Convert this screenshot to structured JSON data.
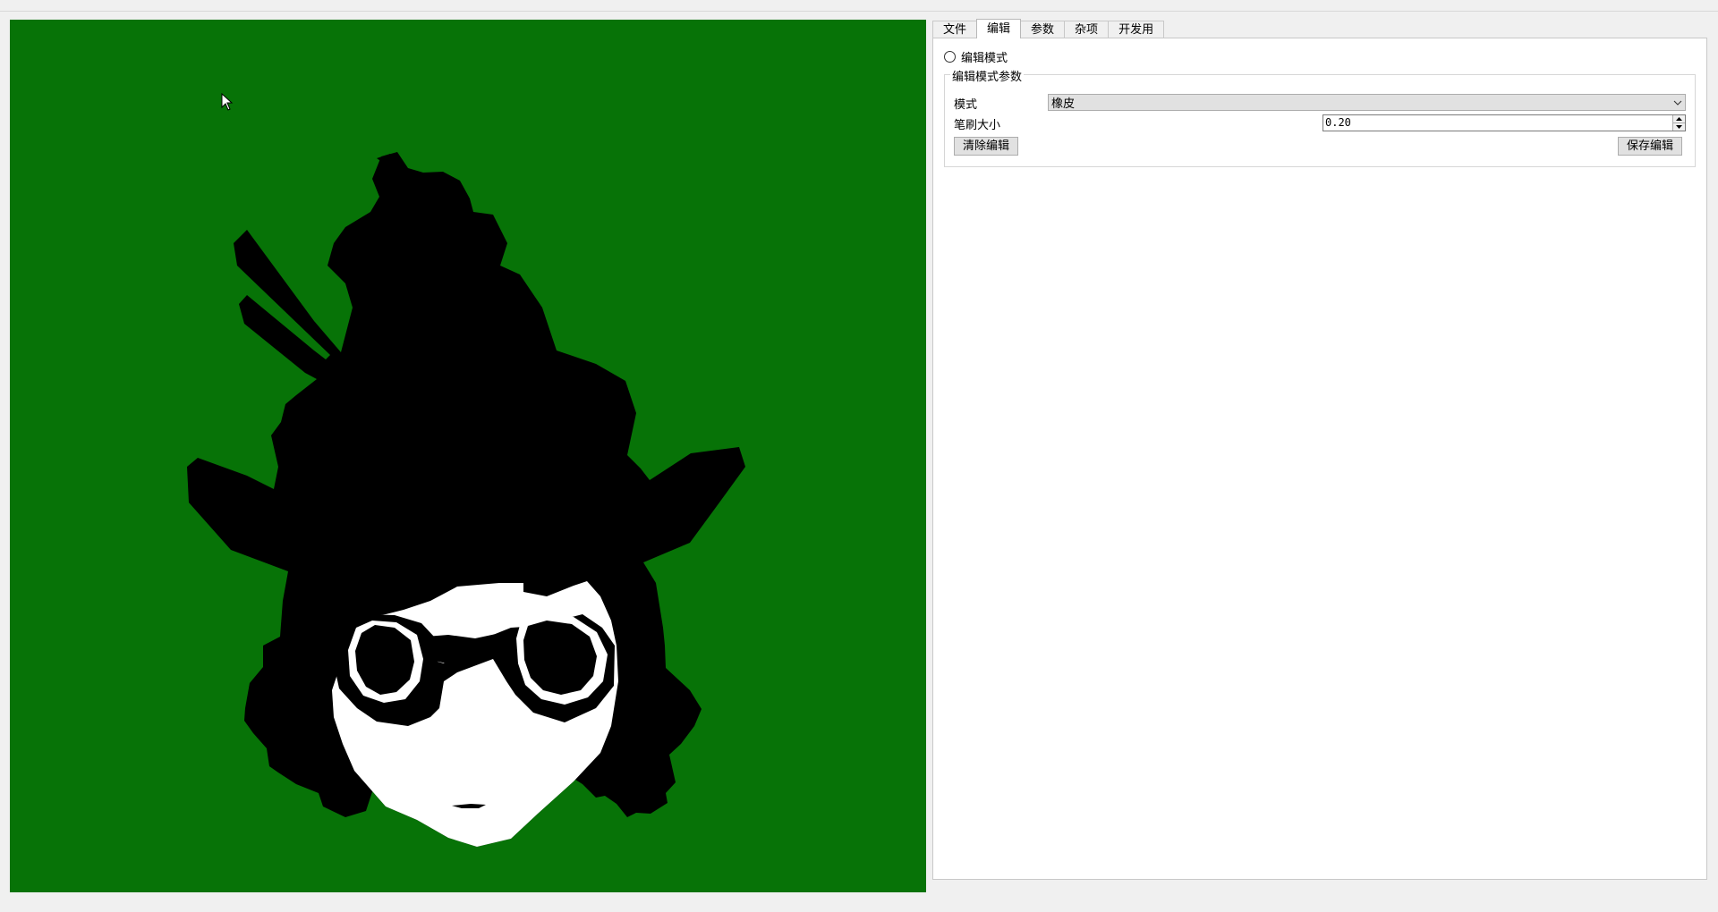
{
  "tabs": [
    {
      "label": "文件"
    },
    {
      "label": "编辑",
      "active": true
    },
    {
      "label": "参数"
    },
    {
      "label": "杂项"
    },
    {
      "label": "开发用"
    }
  ],
  "edit": {
    "edit_mode_label": "编辑模式",
    "edit_mode_checked": false,
    "group_title": "编辑模式参数",
    "mode_label": "模式",
    "mode_value": "橡皮",
    "brush_size_label": "笔刷大小",
    "brush_size_value": "0.20",
    "clear_button": "清除编辑",
    "save_button": "保存编辑"
  },
  "colors": {
    "viewport_bg": "#077307",
    "silhouette": "#000000",
    "face": "#ffffff"
  },
  "icons": {
    "cursor": "arrow-cursor-icon",
    "dropdown": "chevron-down-icon",
    "spin_up": "spin-up-icon",
    "spin_down": "spin-down-icon"
  }
}
